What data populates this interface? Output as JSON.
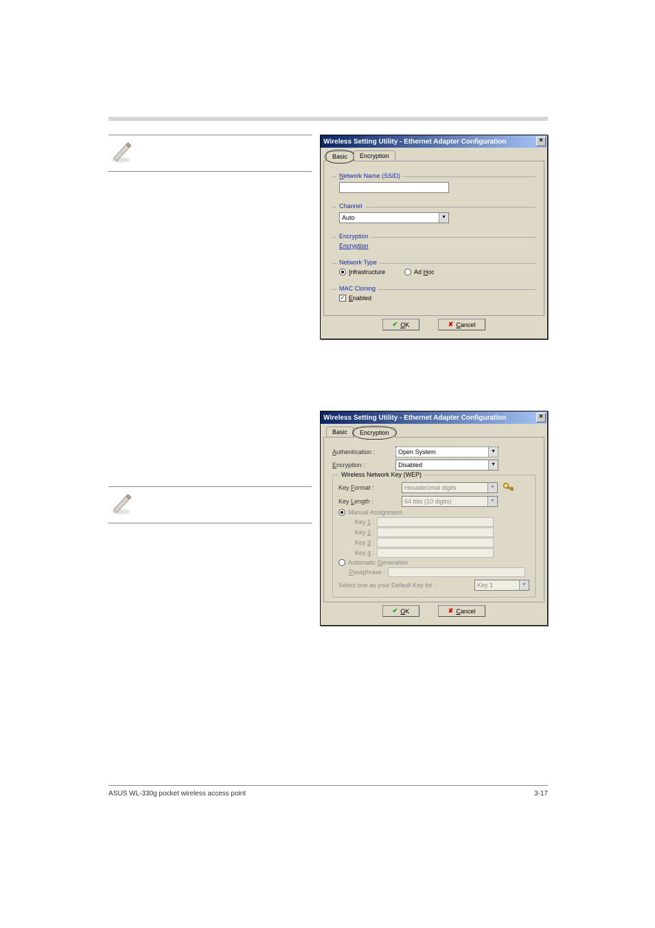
{
  "dialog1": {
    "title": "Wireless Setting Utility - Ethernet Adapter Configuration",
    "tabs": {
      "basic": "Basic",
      "encryption": "Encryption"
    },
    "ssid_label": "Network Name (SSID)",
    "ssid_value": "",
    "channel_label": "Channel",
    "channel_value": "Auto",
    "encryption_group": "Encryption",
    "encryption_link": "Encryption",
    "nettype_label": "Network Type",
    "radio_infra": "Infrastructure",
    "radio_adhoc": "Ad Hoc",
    "mac_label": "MAC Cloning",
    "mac_enabled": "Enabled",
    "ok": "OK",
    "cancel": "Cancel"
  },
  "dialog2": {
    "title": "Wireless Setting Utility - Ethernet Adapter Configuration",
    "tabs": {
      "basic": "Basic",
      "encryption": "Encryption"
    },
    "auth_label": "Authentication :",
    "auth_value": "Open System",
    "enc_label": "Encryption :",
    "enc_value": "Disabled",
    "wep_group": "Wireless Network Key (WEP)",
    "keyformat_label": "Key Format :",
    "keyformat_value": "Hexadecimal digits",
    "keylength_label": "Key Length :",
    "keylength_value": "64 bits (10 digits)",
    "manual_radio": "Manual Assignment",
    "key1": "Key 1 :",
    "key2": "Key 2 :",
    "key3": "Key 3 :",
    "key4": "Key 4 :",
    "auto_radio": "Automatic Generation",
    "passphrase": "Passphrase :",
    "default_label": "Select one as your Default Key for :",
    "default_value": "Key 1",
    "ok": "OK",
    "cancel": "Cancel"
  },
  "footer": {
    "left": "ASUS WL-330g pocket wireless access point",
    "right": "3-17"
  }
}
